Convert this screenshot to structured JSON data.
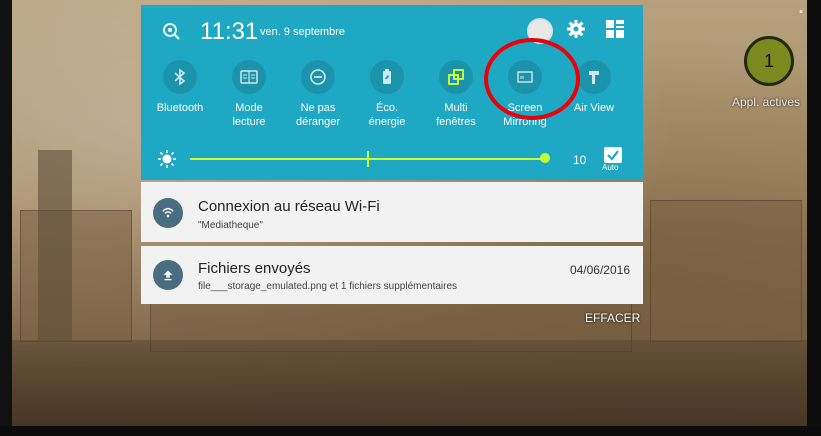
{
  "status": {
    "time": "11:31",
    "date": "ven. 9 septembre"
  },
  "quick_settings": [
    {
      "label_1": "Bluetooth",
      "label_2": "",
      "icon": "bluetooth-icon"
    },
    {
      "label_1": "Mode",
      "label_2": "lecture",
      "icon": "reading-mode-icon"
    },
    {
      "label_1": "Ne pas",
      "label_2": "déranger",
      "icon": "do-not-disturb-icon"
    },
    {
      "label_1": "Éco.",
      "label_2": "énergie",
      "icon": "battery-saver-icon"
    },
    {
      "label_1": "Multi",
      "label_2": "fenêtres",
      "icon": "multi-window-icon"
    },
    {
      "label_1": "Screen",
      "label_2": "Mirroring",
      "icon": "screen-mirroring-icon"
    },
    {
      "label_1": "Air View",
      "label_2": "",
      "icon": "air-view-icon"
    }
  ],
  "brightness": {
    "value": "10",
    "auto_label": "Auto"
  },
  "notifications": [
    {
      "title": "Connexion au réseau Wi-Fi",
      "subtitle": "\"Mediatheque\"",
      "date": "",
      "icon": "wifi-icon"
    },
    {
      "title": "Fichiers envoyés",
      "subtitle": "file___storage_emulated.png et 1 fichiers supplémentaires",
      "date": "04/06/2016",
      "icon": "upload-icon"
    }
  ],
  "clear_label": "EFFACER",
  "active_apps": {
    "count": "1",
    "label": "Appl. actives"
  },
  "colors": {
    "panel": "#1fa8c3",
    "slider": "#c8ff38",
    "highlight": "#e8000b"
  }
}
